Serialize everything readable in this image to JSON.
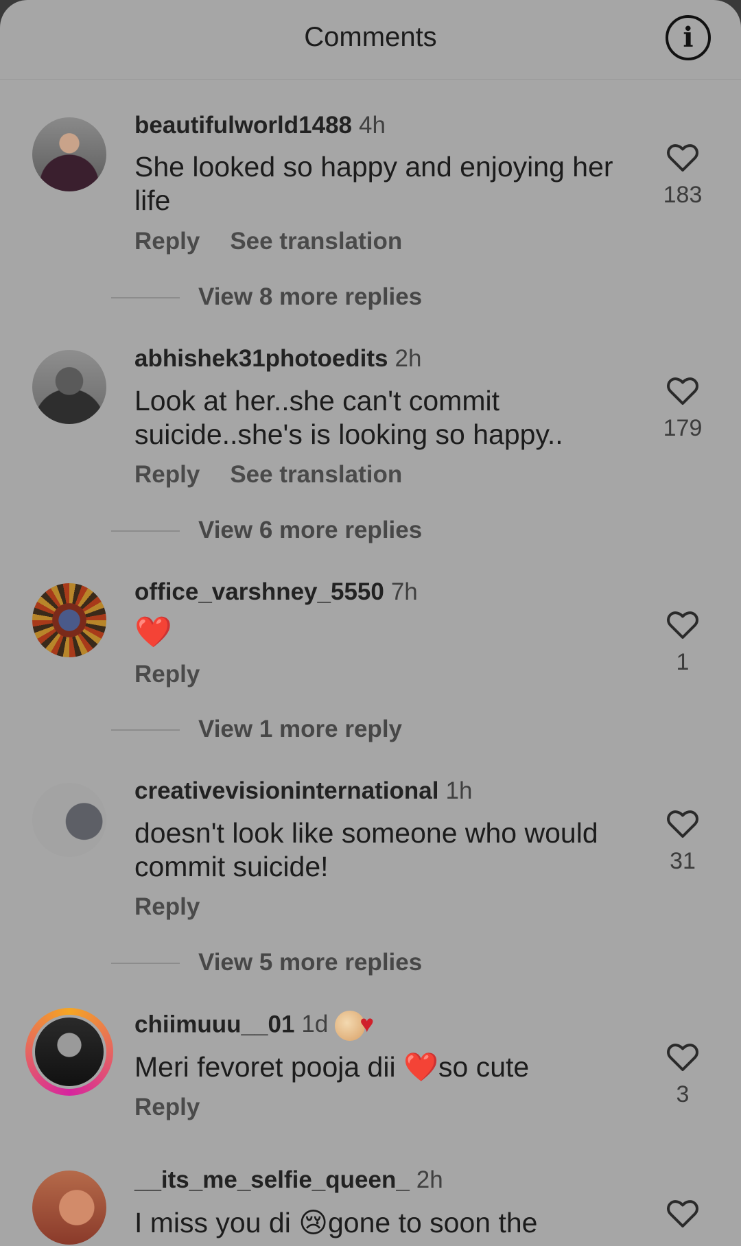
{
  "header": {
    "title": "Comments"
  },
  "comments": [
    {
      "username": "beautifulworld1488",
      "time": "4h",
      "text": "She looked so happy and enjoying her life",
      "likes": "183",
      "reply": "Reply",
      "translate": "See translation",
      "view_replies": "View 8 more replies"
    },
    {
      "username": "abhishek31photoedits",
      "time": "2h",
      "text": "Look at her..she can't commit suicide..she's is looking so happy..",
      "likes": "179",
      "reply": "Reply",
      "translate": "See translation",
      "view_replies": "View 6 more replies"
    },
    {
      "username": "office_varshney_5550",
      "time": "7h",
      "text": "❤️",
      "likes": "1",
      "reply": "Reply",
      "view_replies": "View 1 more reply"
    },
    {
      "username": "creativevisioninternational",
      "time": "1h",
      "text": "doesn't look like someone who would commit suicide!",
      "likes": "31",
      "reply": "Reply",
      "view_replies": "View 5 more replies"
    },
    {
      "username": "chiimuuu__01",
      "time": "1d",
      "text": "Meri fevoret pooja dii ❤️so cute",
      "likes": "3",
      "reply": "Reply"
    },
    {
      "username": "__its_me_selfie_queen_",
      "time": "2h",
      "text": "I miss you di 😢gone to soon the"
    }
  ],
  "colors": {
    "sheet": "#a6a6a6",
    "like_heart_stroke": "#2a2a2a",
    "story_ring": [
      "#f5a623",
      "#d6249f"
    ]
  }
}
